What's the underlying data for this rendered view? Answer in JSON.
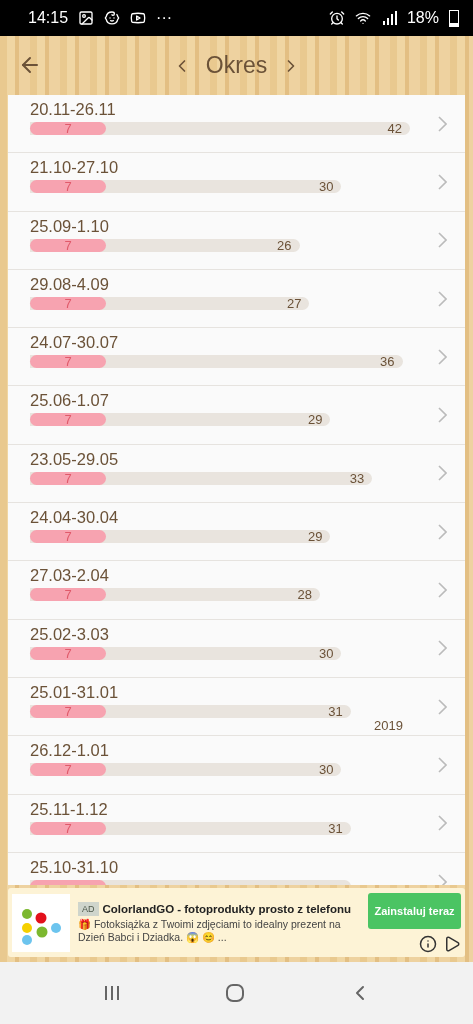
{
  "status_bar": {
    "time": "14:15",
    "more": "···",
    "battery": "18%"
  },
  "header": {
    "title": "Okres"
  },
  "periods": [
    {
      "range": "20.11-26.11",
      "highlight": {
        "value": "7",
        "level": 0.2
      },
      "bar": {
        "value": "42"
      }
    },
    {
      "range": "21.10-27.10",
      "highlight": {
        "value": "7",
        "level": 0.244
      },
      "bar": {
        "value": "30"
      }
    },
    {
      "range": "25.09-1.10",
      "highlight": {
        "value": "7",
        "level": 0.282
      },
      "bar": {
        "value": "26"
      }
    },
    {
      "range": "29.08-4.09",
      "highlight": {
        "value": "7",
        "level": 0.272
      },
      "bar": {
        "value": "27"
      }
    },
    {
      "range": "24.07-30.07",
      "highlight": {
        "value": "7",
        "level": 0.204
      },
      "bar": {
        "value": "36"
      }
    },
    {
      "range": "25.06-1.07",
      "highlight": {
        "value": "7",
        "level": 0.253
      },
      "bar": {
        "value": "29"
      }
    },
    {
      "range": "23.05-29.05",
      "highlight": {
        "value": "7",
        "level": 0.222
      },
      "bar": {
        "value": "33"
      }
    },
    {
      "range": "24.04-30.04",
      "highlight": {
        "value": "7",
        "level": 0.253
      },
      "bar": {
        "value": "29"
      }
    },
    {
      "range": "27.03-2.04",
      "highlight": {
        "value": "7",
        "level": 0.262
      },
      "bar": {
        "value": "28"
      }
    },
    {
      "range": "25.02-3.03",
      "highlight": {
        "value": "7",
        "level": 0.244
      },
      "bar": {
        "value": "30"
      }
    },
    {
      "range": "25.01-31.01",
      "highlight": {
        "value": "7",
        "level": 0.237
      },
      "bar": {
        "value": "31"
      },
      "year": "2019"
    },
    {
      "range": "26.12-1.01",
      "highlight": {
        "value": "7",
        "level": 0.244
      },
      "bar": {
        "value": "30"
      }
    },
    {
      "range": "25.11-1.12",
      "highlight": {
        "value": "7",
        "level": 0.237
      },
      "bar": {
        "value": "31"
      }
    },
    {
      "range": "25.10-31.10",
      "highlight": {
        "level": 0.237
      }
    }
  ],
  "ad": {
    "badge": "AD",
    "title": "ColorlandGO - fotoprodukty prosto z telefonu",
    "text": "🎁 Fotoksiążka z Twoimi zdjęciami to idealny prezent na Dzień Babci i Dziadka. 😱 😊 ...",
    "button": "Zainstaluj teraz"
  }
}
